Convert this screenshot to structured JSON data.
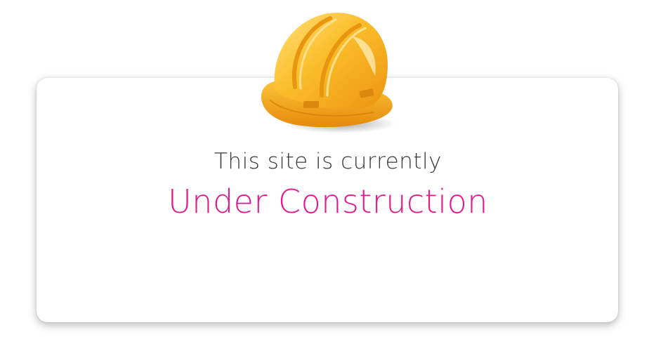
{
  "notice": {
    "intro_text": "This site is currently",
    "headline_text": "Under Construction"
  },
  "icons": {
    "helmet": "hard-hat-icon"
  },
  "colors": {
    "headline": "#e3168f",
    "intro": "#3a3a3a",
    "helmet": "#f7b21c",
    "card_background": "#ffffff"
  }
}
